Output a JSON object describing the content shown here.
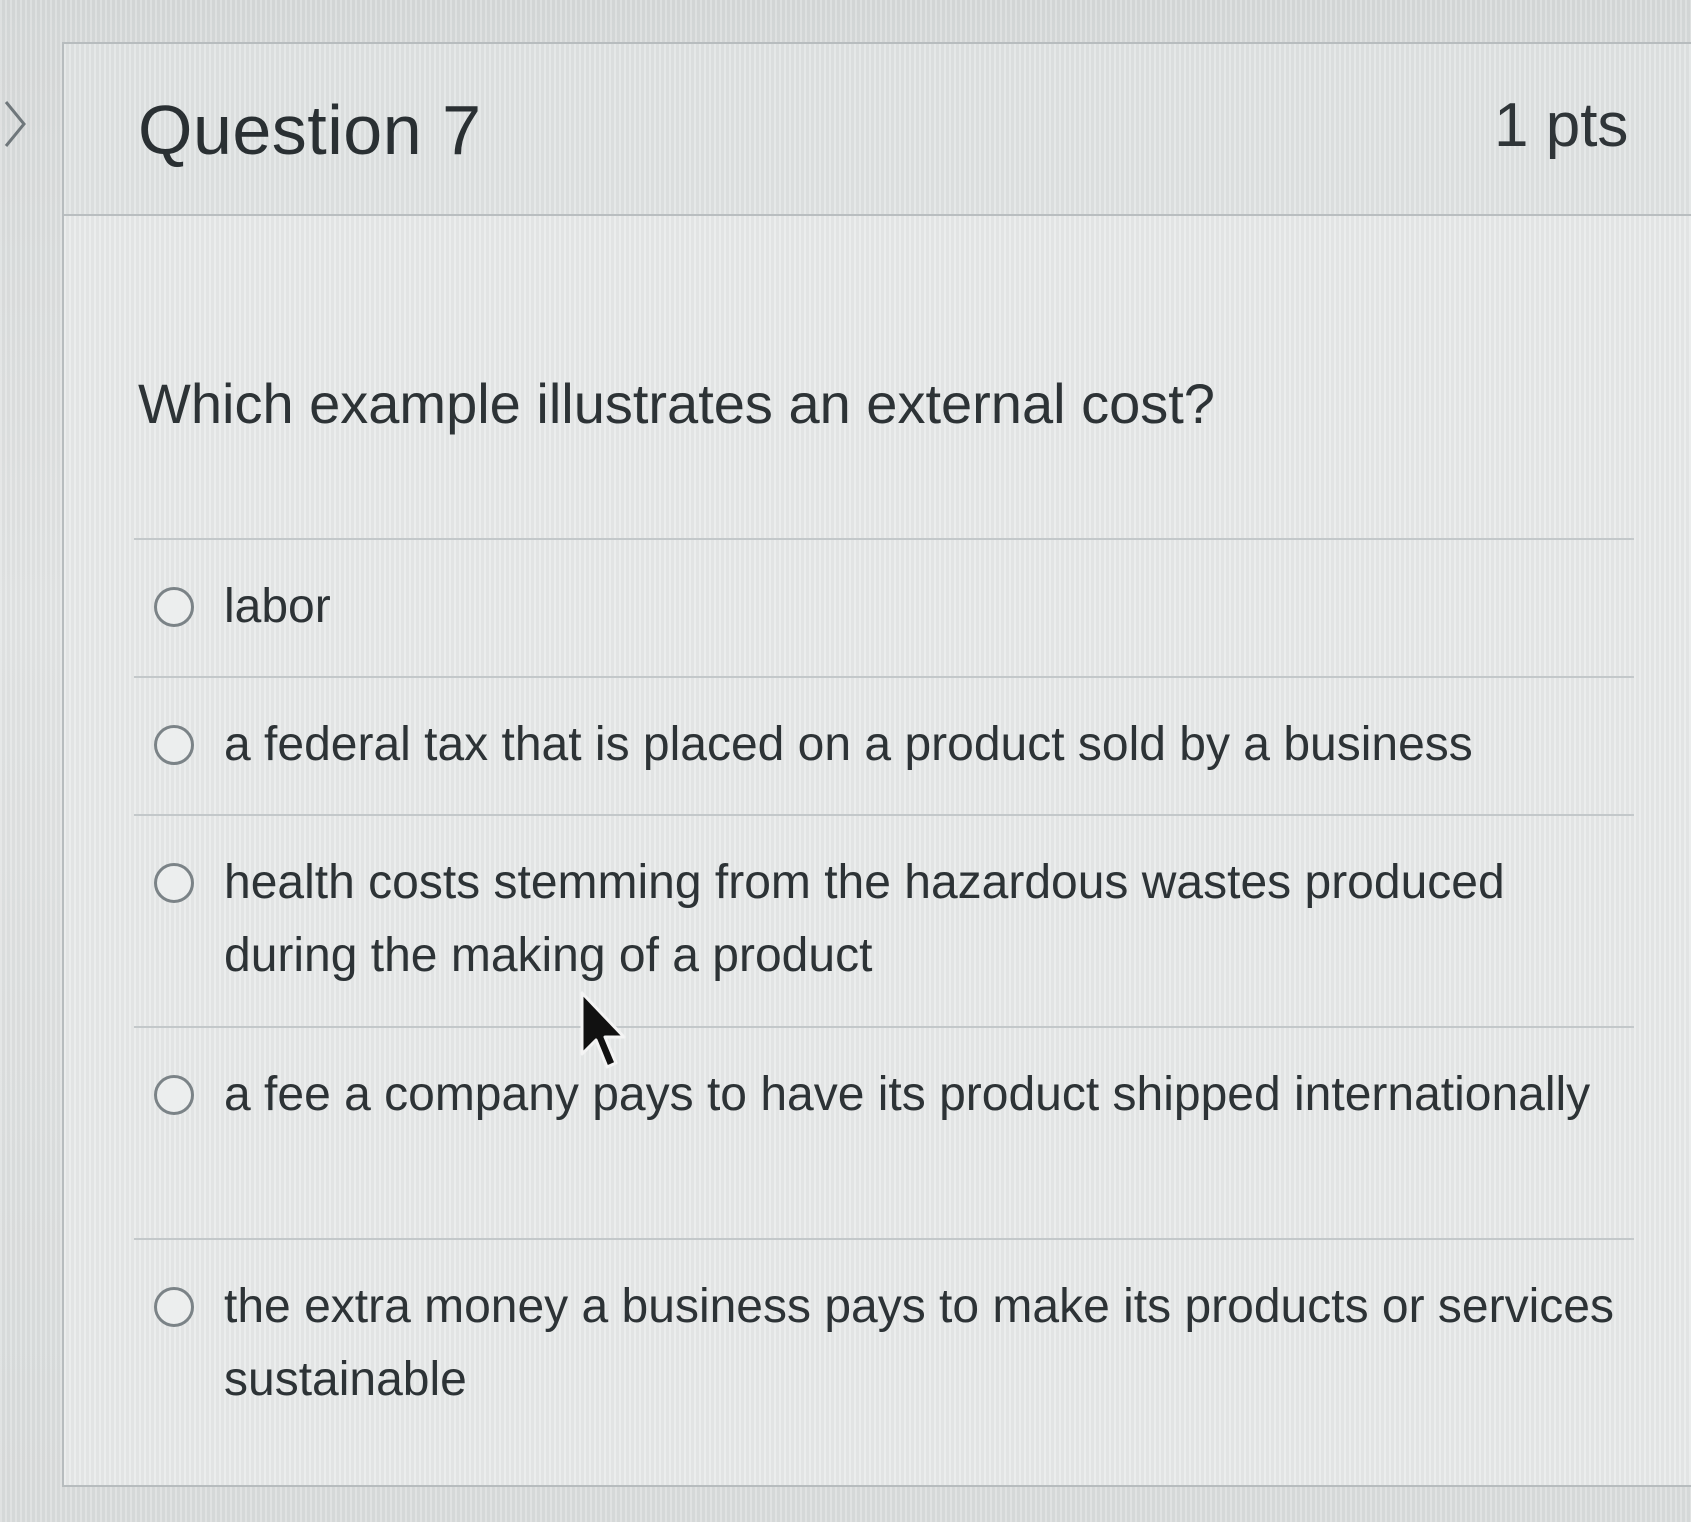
{
  "question": {
    "title": "Question 7",
    "points": "1 pts",
    "text": "Which example illustrates an external cost?",
    "answers": [
      {
        "label": "labor",
        "selected": false
      },
      {
        "label": "a federal tax that is placed on a product sold by a business",
        "selected": false
      },
      {
        "label": "health costs stemming from the hazardous wastes produced during the making of a product",
        "selected": false
      },
      {
        "label": "a fee a company pays to have its product shipped internationally",
        "selected": false
      },
      {
        "label": "the extra money a business pays to make its products or services sustainable",
        "selected": false
      }
    ]
  },
  "icons": {
    "collapse": "chevron-right-icon",
    "radio": "radio-button-icon",
    "cursor": "mouse-pointer-icon"
  }
}
